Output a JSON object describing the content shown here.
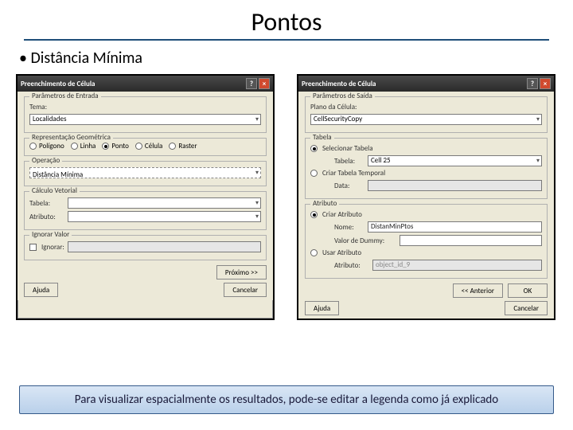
{
  "slide": {
    "title": "Pontos",
    "bullet1": "Distância Mínima",
    "footer": "Para visualizar espacialmente os resultados, pode-se editar a legenda como já explicado"
  },
  "dialog1": {
    "title": "Preenchimento de Célula",
    "group_entrada": "Parâmetros de Entrada",
    "tema_label": "Tema:",
    "tema_value": "Localidades",
    "rep_geo": "Representação Geométrica",
    "rep_options": {
      "poligono": "Polígono",
      "linha": "Linha",
      "ponto": "Ponto",
      "celula": "Célula",
      "raster": "Raster"
    },
    "operacao": "Operação",
    "operacao_value": "Distância Mínima",
    "calculo": "Cálculo Vetorial",
    "tabela_label": "Tabela:",
    "atributo_label": "Atributo:",
    "ignorar": "Ignorar Valor",
    "ignorar_check": "Ignorar:",
    "btn_next": "Próximo >>",
    "btn_help": "Ajuda",
    "btn_cancel": "Cancelar"
  },
  "dialog2": {
    "title": "Preenchimento de Célula",
    "group_saida": "Parâmetros de Saída",
    "plano_label": "Plano da Célula:",
    "plano_value": "CellSecurityCopy",
    "tabela_group": "Tabela",
    "sel_tabela": "Selecionar Tabela",
    "tabela_label": "Tabela:",
    "tabela_value": "Cell 25",
    "criar_tabela": "Criar Tabela Temporal",
    "data_label": "Data:",
    "atributo_group": "Atributo",
    "criar_atributo": "Criar Atributo",
    "nome_label": "Nome:",
    "nome_value": "DistanMinPtos",
    "valor_dummy": "Valor de Dummy:",
    "usar_atributo": "Usar Atributo",
    "atributo_label": "Atributo:",
    "atributo_value": "object_id_9",
    "btn_prev": "<< Anterior",
    "btn_ok": "OK",
    "btn_help": "Ajuda",
    "btn_cancel": "Cancelar"
  }
}
